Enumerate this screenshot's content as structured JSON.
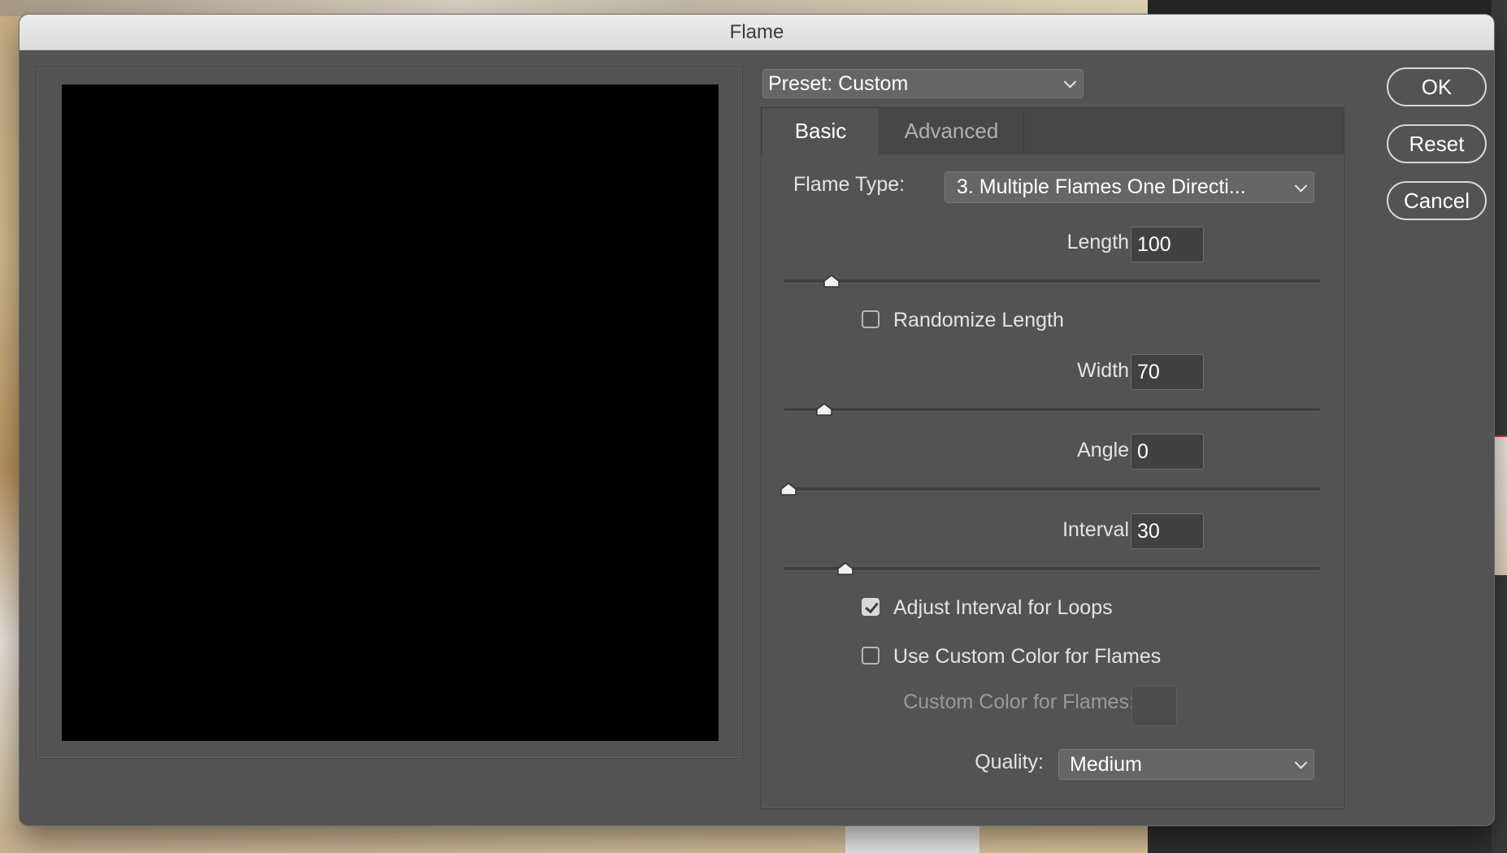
{
  "dialog": {
    "title": "Flame"
  },
  "preset": {
    "label": "Preset: Custom"
  },
  "tabs": [
    {
      "label": "Basic",
      "active": true
    },
    {
      "label": "Advanced",
      "active": false
    }
  ],
  "flame_type": {
    "label": "Flame Type:",
    "value": "3. Multiple Flames One Directi..."
  },
  "length": {
    "label": "Length:",
    "value": "100",
    "slider_fraction": 0.09
  },
  "randomize_length": {
    "label": "Randomize Length",
    "checked": false
  },
  "width": {
    "label": "Width:",
    "value": "70",
    "slider_fraction": 0.075
  },
  "angle": {
    "label": "Angle:",
    "value": "0",
    "slider_fraction": 0.0
  },
  "interval": {
    "label": "Interval:",
    "value": "30",
    "slider_fraction": 0.115
  },
  "adjust_interval": {
    "label": "Adjust Interval for Loops",
    "checked": true
  },
  "custom_color": {
    "label": "Use Custom Color for Flames",
    "checked": false
  },
  "custom_color_swatch": {
    "label": "Custom Color for Flames:"
  },
  "quality": {
    "label": "Quality:",
    "value": "Medium"
  },
  "buttons": {
    "ok": "OK",
    "reset": "Reset",
    "cancel": "Cancel"
  },
  "colors": {
    "dialog_bg": "#535353",
    "preview_bg": "#000000",
    "titlebar": "#e3e3e3"
  }
}
